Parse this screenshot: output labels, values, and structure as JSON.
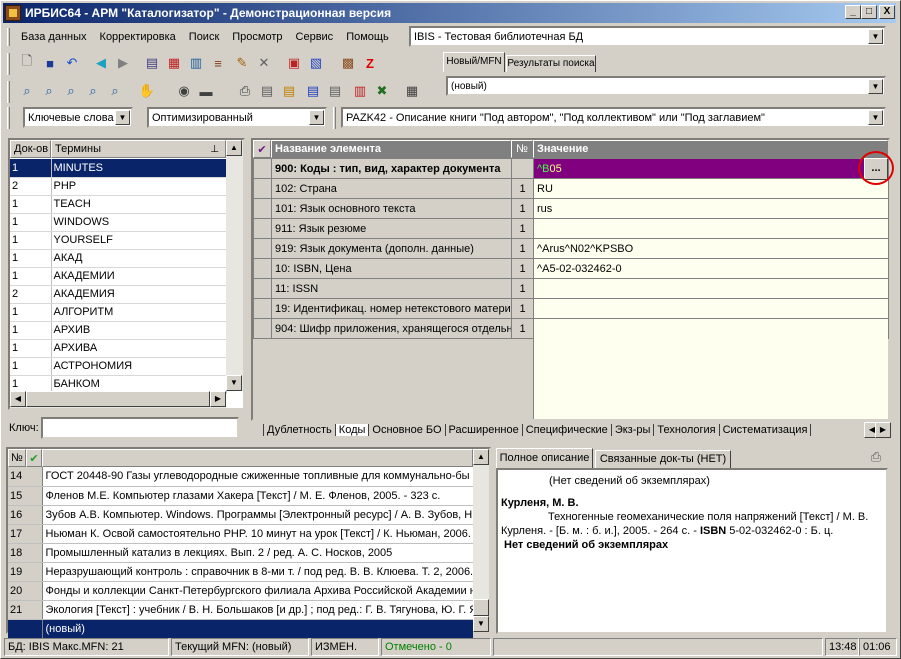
{
  "window": {
    "title": "ИРБИС64 - АРМ \"Каталогизатор\" - Демонстрационная версия",
    "minimize": "_",
    "maximize": "□",
    "close": "X"
  },
  "menu": [
    "База данных",
    "Корректировка",
    "Поиск",
    "Просмотр",
    "Сервис",
    "Помощь"
  ],
  "database_select": "IBIS - Тестовая библиотечная БД",
  "right_tabs": {
    "new_mfn": "Новый/MFN",
    "search_results": "Результаты поиска"
  },
  "new_record_select": "(новый)",
  "search_mode": "Ключевые слова",
  "optimization": "Оптимизированный",
  "worksheet": "PAZK42 - Описание книги \"Под автором\", \"Под коллективом\" или \"Под заглавием\"",
  "terms": {
    "col_docs": "Док-ов",
    "col_terms": "Термины",
    "rows": [
      {
        "count": "1",
        "term": "MINUTES"
      },
      {
        "count": "2",
        "term": "PHP"
      },
      {
        "count": "1",
        "term": "TEACH"
      },
      {
        "count": "1",
        "term": "WINDOWS"
      },
      {
        "count": "1",
        "term": "YOURSELF"
      },
      {
        "count": "1",
        "term": "АКАД"
      },
      {
        "count": "1",
        "term": "АКАДЕМИИ"
      },
      {
        "count": "2",
        "term": "АКАДЕМИЯ"
      },
      {
        "count": "1",
        "term": "АЛГОРИТМ"
      },
      {
        "count": "1",
        "term": "АРХИВ"
      },
      {
        "count": "1",
        "term": "АРХИВА"
      },
      {
        "count": "1",
        "term": "АСТРОНОМИЯ"
      },
      {
        "count": "1",
        "term": "БАНКОМ"
      }
    ],
    "key_label": "Ключ:",
    "key_value": ""
  },
  "fields": {
    "col_name": "Название элемента",
    "col_no": "№",
    "col_value": "Значение",
    "rows": [
      {
        "name": "900: Коды : тип, вид, характер документа",
        "no": "",
        "value": "^B05"
      },
      {
        "name": "102: Страна",
        "no": "1",
        "value": "RU"
      },
      {
        "name": "101: Язык основного текста",
        "no": "1",
        "value": "rus"
      },
      {
        "name": "911: Язык резюме",
        "no": "1",
        "value": ""
      },
      {
        "name": "919: Язык документа (дополн. данные)",
        "no": "1",
        "value": "^Arus^N02^KPSBO"
      },
      {
        "name": "10: ISBN, Цена",
        "no": "1",
        "value": "^A5-02-032462-0"
      },
      {
        "name": "11: ISSN",
        "no": "1",
        "value": ""
      },
      {
        "name": "19: Идентификац. номер нетекстового матери",
        "no": "1",
        "value": ""
      },
      {
        "name": "904: Шифр приложения, хранящегося отдельно",
        "no": "1",
        "value": ""
      }
    ],
    "ellipsis": "..."
  },
  "bottom_tabs": [
    "Дублетность",
    "Коды",
    "Основное БО",
    "Расширенное",
    "Специфические",
    "Экз-ры",
    "Технология",
    "Систематизация"
  ],
  "records": {
    "col_no": "№",
    "rows": [
      {
        "n": "14",
        "text": "ГОСТ 20448-90 Газы углеводородные сжиженные топливные для коммунально-бы"
      },
      {
        "n": "15",
        "text": "Фленов М.Е. Компьютер глазами Хакера [Текст] / М. Е. Фленов, 2005. - 323 с."
      },
      {
        "n": "16",
        "text": "Зубов А.В. Компьютер. Windows. Программы [Электронный ресурс] / А. В. Зубов, Н"
      },
      {
        "n": "17",
        "text": "Ньюман К. Освой самостоятельно PHP. 10 минут на урок [Текст] / К. Ньюман, 2006."
      },
      {
        "n": "18",
        "text": "Промышленный катализ в лекциях. Вып. 2 / ред. А. С. Носков, 2005"
      },
      {
        "n": "19",
        "text": "Неразрушающий контроль : справочник в 8-ми т. / под ред. В. В. Клюева. Т. 2, 2006."
      },
      {
        "n": "20",
        "text": "Фонды и коллекции Санкт-Петербургского филиала Архива Российской Академии н"
      },
      {
        "n": "21",
        "text": "Экология [Текст] : учебник / В. Н. Большаков [и др.] ; под ред.: Г. В. Тягунова, Ю. Г. Я"
      },
      {
        "n": "",
        "text": "(новый)"
      }
    ]
  },
  "desc_tabs": {
    "full": "Полное описание",
    "related": "Связанные док-ты (НЕТ)"
  },
  "description": {
    "line1": "(Нет сведений об экземплярах)",
    "author": "Курленя, М. В.",
    "title_line": "Техногенные геомеханические поля напряжений [Текст] / М. В.",
    "imprint_a": "Курленя. - [Б. м. : б. и.], 2005. - 264 с. - ",
    "isbn_label": "ISBN",
    "imprint_b": " 5-02-032462-0 : Б. ц.",
    "no_copies": "Нет сведений об экземплярах"
  },
  "status": {
    "db": "БД: IBIS Макс.MFN: 21",
    "current": "Текущий MFN: (новый)",
    "changed": "ИЗМЕН.",
    "marked": "Отмечено - 0",
    "time": "13:48",
    "date": "01:06"
  },
  "colors": {
    "selection": "#0a246a",
    "current_row": "#800080",
    "value_bg": "#fffff0",
    "marked": "#008000",
    "highlight": "#e00000"
  }
}
